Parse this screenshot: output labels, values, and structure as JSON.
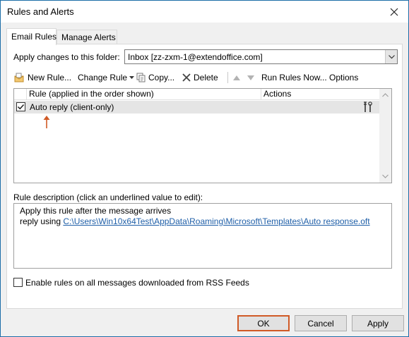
{
  "window": {
    "title": "Rules and Alerts"
  },
  "tabs": [
    {
      "label": "Email Rules"
    },
    {
      "label": "Manage Alerts"
    }
  ],
  "folder": {
    "label": "Apply changes to this folder:",
    "value": "Inbox [zz-zxm-1@extendoffice.com]"
  },
  "toolbar": {
    "new_rule": "New Rule...",
    "change_rule": "Change Rule",
    "copy": "Copy...",
    "delete": "Delete",
    "run_rules_now": "Run Rules Now...",
    "options": "Options"
  },
  "rules_list": {
    "columns": [
      "Rule (applied in the order shown)",
      "Actions"
    ],
    "rows": [
      {
        "name": "Auto reply  (client-only)",
        "checked": true
      }
    ]
  },
  "description": {
    "label": "Rule description (click an underlined value to edit):",
    "line1": "Apply this rule after the message arrives",
    "line2_prefix": "reply using ",
    "line2_link": "C:\\Users\\Win10x64Test\\AppData\\Roaming\\Microsoft\\Templates\\Auto response.oft"
  },
  "rss": {
    "label": "Enable rules on all messages downloaded from RSS Feeds",
    "checked": false
  },
  "buttons": {
    "ok": "OK",
    "cancel": "Cancel",
    "apply": "Apply"
  },
  "colors": {
    "accent": "#d05a26",
    "link": "#1f5fa8",
    "frame": "#1d6ea8"
  }
}
